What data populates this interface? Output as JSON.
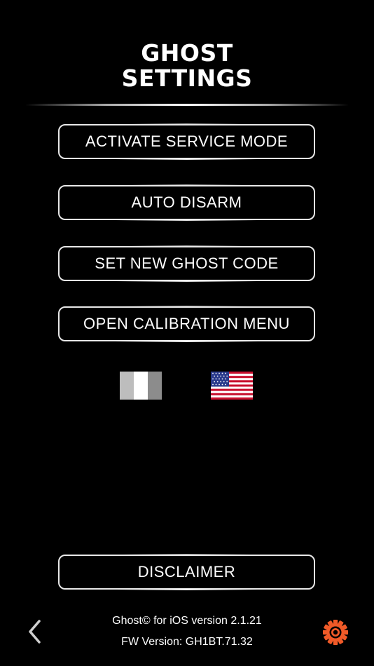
{
  "header": {
    "title_line1": "GHOST",
    "title_line2": "SETTINGS"
  },
  "menu": {
    "items": [
      {
        "label": "ACTIVATE SERVICE MODE"
      },
      {
        "label": "AUTO DISARM"
      },
      {
        "label": "SET NEW GHOST CODE"
      },
      {
        "label": "OPEN CALIBRATION MENU"
      }
    ]
  },
  "languages": [
    {
      "icon": "italy-flag-icon"
    },
    {
      "icon": "usa-flag-icon"
    }
  ],
  "disclaimer": {
    "label": "DISCLAIMER"
  },
  "footer": {
    "version": "Ghost© for iOS version 2.1.21",
    "fw_version": "FW Version: GH1BT.71.32"
  },
  "icons": {
    "back": "chevron-left-icon",
    "settings": "gear-icon"
  },
  "colors": {
    "background": "#000000",
    "text": "#ffffff",
    "button_border": "#e8e8e8",
    "gear": "#f05a28"
  }
}
